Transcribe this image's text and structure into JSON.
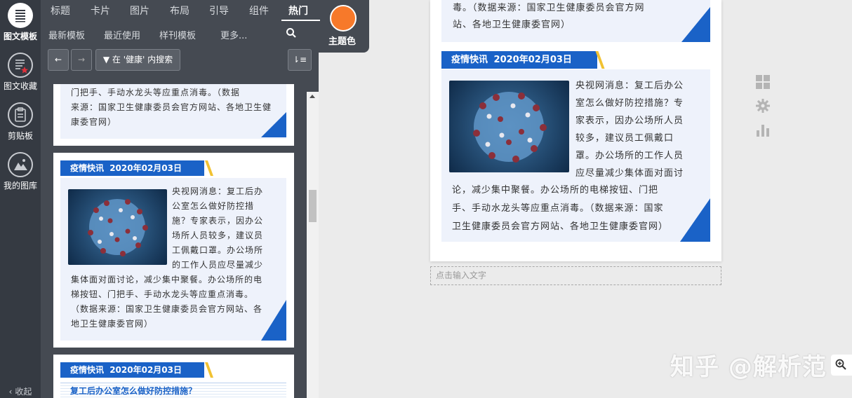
{
  "rail": {
    "top_label": "图文模板",
    "items": [
      {
        "label": "图文收藏",
        "icon": "document-star-icon"
      },
      {
        "label": "剪贴板",
        "icon": "clipboard-icon"
      },
      {
        "label": "我的图库",
        "icon": "image-gallery-icon"
      }
    ],
    "collapse_label": "收起"
  },
  "nav": {
    "tabs": [
      "标题",
      "卡片",
      "图片",
      "布局",
      "引导",
      "组件",
      "热门"
    ],
    "active_tab": "热门",
    "subtabs": [
      "最新模板",
      "最近使用",
      "样刊模板",
      "更多..."
    ],
    "theme_label": "主题色",
    "theme_color": "#f7792a"
  },
  "toolbar": {
    "search_in_label": "在 '健康' 内搜索"
  },
  "list": {
    "card1_text": [
      "门把手、手动水龙头等应重点消毒。（数据",
      "来源：国家卫生健康委员会官方网站、各地卫生健",
      "康委官网）"
    ],
    "card2": {
      "tag_title": "疫情快讯",
      "tag_date": "2020年02月03日",
      "side_lines": [
        "央视网消息：复工后办",
        "公室怎么做好防控措",
        "施？专家表示，因办公",
        "场所人员较多，建议员",
        "工佩戴口罩。办公场所",
        "的工作人员应尽量减少"
      ],
      "full_lines": [
        "集体面对面讨论，减少集中聚餐。办公场所的电",
        "梯按钮、门把手、手动水龙头等应重点消毒。",
        "（数据来源：国家卫生健康委员会官方网站、各",
        "地卫生健康委官网）"
      ]
    },
    "card3": {
      "tag_title": "疫情快讯",
      "tag_date": "2020年02月03日",
      "subtitle": "复工后办公室怎么做好防控措施？"
    }
  },
  "editor": {
    "top_lines": [
      "毒。（数据来源：国家卫生健康委员会官方网",
      "站、各地卫生健康委官网）"
    ],
    "tag_title": "疫情快讯",
    "tag_date": "2020年02月03日",
    "side_lines": [
      "央视网消息：复工后办公",
      "室怎么做好防控措施？专",
      "家表示，因办公场所人员",
      "较多，建议员工佩戴口",
      "罩。办公场所的工作人员",
      "应尽量减少集体面对面讨"
    ],
    "full_lines": [
      "论，减少集中聚餐。办公场所的电梯按钮、门把",
      "手、手动水龙头等应重点消毒。（数据来源：国家",
      "卫生健康委员会官方网站、各地卫生健康委官网）"
    ],
    "input_placeholder": "点击输入文字"
  },
  "right_icons": [
    "grid-icon",
    "gear-icon",
    "bar-chart-icon"
  ],
  "watermark": "知乎 @解析范",
  "colors": {
    "accent_blue": "#1a62c7",
    "accent_yellow": "#f1c232",
    "rail_bg": "#353a42",
    "panel_bg": "#454a52"
  }
}
